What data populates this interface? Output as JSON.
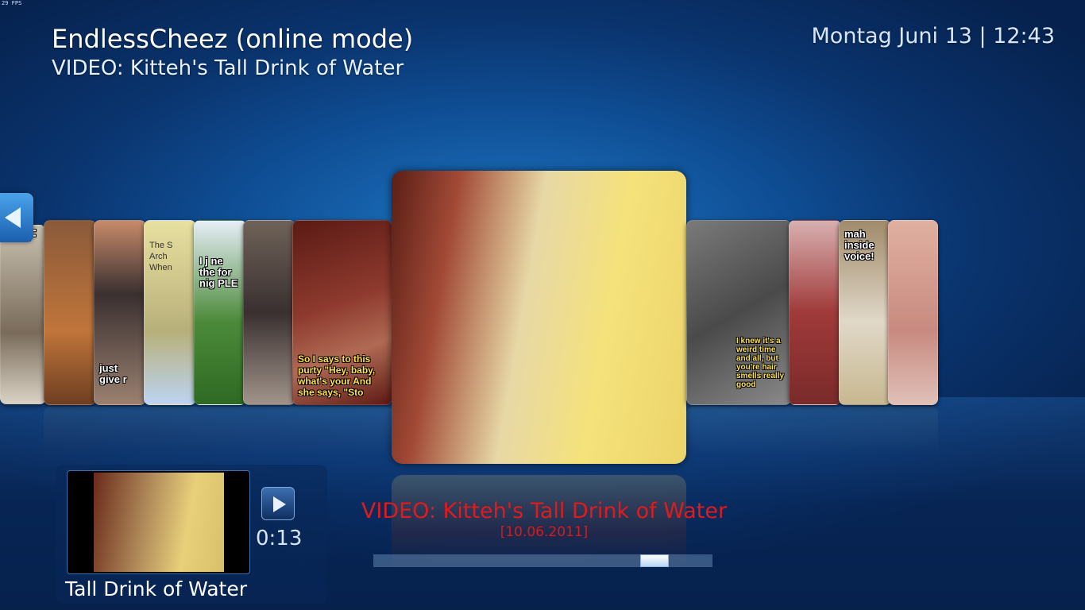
{
  "fps": "29 FPS",
  "header": {
    "title": "EndlessCheez (online mode)",
    "subtitle": "VIDEO: Kitteh's Tall Drink of Water",
    "clock": "Montag Juni 13 | 12:43"
  },
  "coverflow": {
    "left_cards": [
      {
        "caption": "ALF"
      },
      {
        "caption": ""
      },
      {
        "caption": "just give r"
      },
      {
        "caption": "The S Arch When"
      },
      {
        "caption": "I j ne the for nig PLE"
      },
      {
        "caption": ""
      },
      {
        "caption": "So I says to this purty \"Hey, baby, what's your And she says, \"Sto"
      }
    ],
    "right_cards": [
      {
        "caption": "I knew it's a weird time and all, but you're hair smells really good"
      },
      {
        "caption": ""
      },
      {
        "caption": "mah inside voice!"
      },
      {
        "caption": ""
      }
    ]
  },
  "player": {
    "thumb_title": "Tall Drink of Water",
    "duration": "0:13"
  },
  "now_playing": {
    "title": "VIDEO: Kitteh's Tall Drink of Water",
    "date": "[10.06.2011]"
  },
  "scroll": {
    "position_fraction": 0.78
  }
}
